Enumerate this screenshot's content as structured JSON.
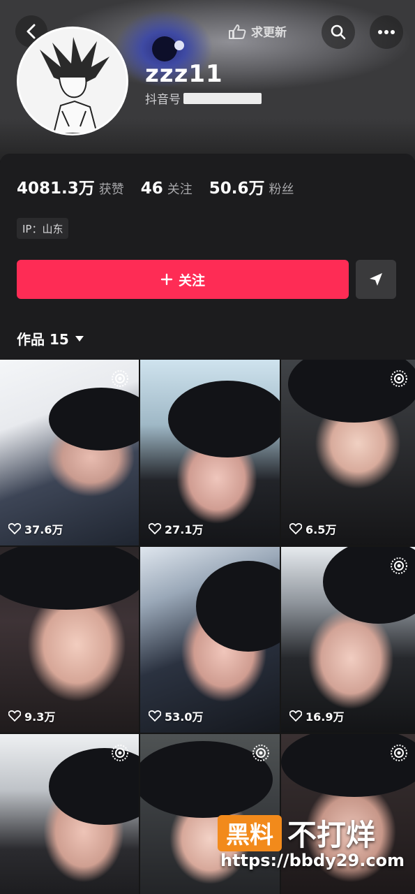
{
  "header": {
    "update_label": "求更新",
    "back_icon": "chevron-left-icon",
    "search_icon": "search-icon",
    "more_icon": "more-dots-icon"
  },
  "profile": {
    "username": "zzz11",
    "douyin_id_label": "抖音号",
    "stats": [
      {
        "value": "4081.3万",
        "label": "获赞"
      },
      {
        "value": "46",
        "label": "关注"
      },
      {
        "value": "50.6万",
        "label": "粉丝"
      }
    ],
    "ip_label": "IP：山东",
    "follow_label": "关注",
    "follow_icon": "plus-icon",
    "share_icon": "send-icon"
  },
  "works": {
    "title": "作品 15",
    "items": [
      {
        "likes": "37.6万"
      },
      {
        "likes": "27.1万"
      },
      {
        "likes": "6.5万"
      },
      {
        "likes": "9.3万"
      },
      {
        "likes": "53.0万"
      },
      {
        "likes": "16.9万"
      },
      {
        "likes": ""
      },
      {
        "likes": ""
      },
      {
        "likes": ""
      }
    ]
  },
  "watermark": {
    "badge": "黑料",
    "text": "不打烊",
    "url": "https://bbdy29.com"
  },
  "colors": {
    "accent": "#fe2c55",
    "background": "#161616",
    "panel": "#1c1c1e",
    "watermark_orange": "#f28a1b"
  }
}
